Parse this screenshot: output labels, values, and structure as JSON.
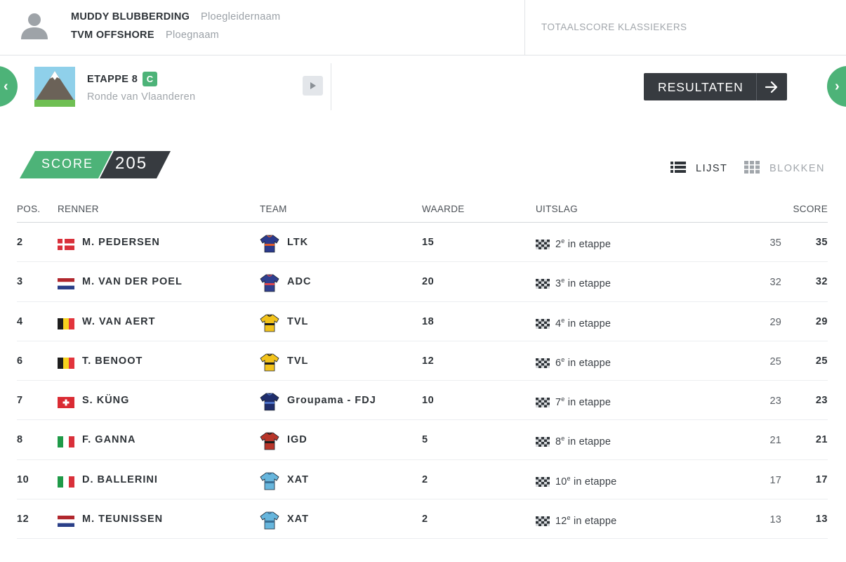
{
  "header": {
    "manager_name": "MUDDY BLUBBERDING",
    "manager_caption": "Ploegleidernaam",
    "team_name": "TVM OFFSHORE",
    "team_caption": "Ploegnaam",
    "total_score_label": "TOTAALSCORE KLASSIEKERS"
  },
  "stage": {
    "title": "ETAPPE 8",
    "badge": "C",
    "subtitle": "Ronde van Vlaanderen",
    "results_button": "RESULTATEN",
    "prev_label": "‹",
    "next_label": "›"
  },
  "score": {
    "label": "SCORE",
    "value": "205"
  },
  "view": {
    "list_label": "LIJST",
    "blocks_label": "BLOKKEN",
    "active": "list"
  },
  "table": {
    "headers": {
      "pos": "POS.",
      "rider": "RENNER",
      "team": "TEAM",
      "value": "WAARDE",
      "result": "UITSLAG",
      "score": "SCORE"
    },
    "rows": [
      {
        "pos": "2",
        "flag": "dk",
        "name": "M. PEDERSEN",
        "jersey": "ltk",
        "team": "LTK",
        "value": "15",
        "place": "2",
        "ordinal": "e",
        "result_suffix": " in etappe",
        "points": "35",
        "score": "35"
      },
      {
        "pos": "3",
        "flag": "nl",
        "name": "M. VAN DER POEL",
        "jersey": "adc",
        "team": "ADC",
        "value": "20",
        "place": "3",
        "ordinal": "e",
        "result_suffix": " in etappe",
        "points": "32",
        "score": "32"
      },
      {
        "pos": "4",
        "flag": "be",
        "name": "W. VAN AERT",
        "jersey": "tvl",
        "team": "TVL",
        "value": "18",
        "place": "4",
        "ordinal": "e",
        "result_suffix": " in etappe",
        "points": "29",
        "score": "29"
      },
      {
        "pos": "6",
        "flag": "be",
        "name": "T. BENOOT",
        "jersey": "tvl",
        "team": "TVL",
        "value": "12",
        "place": "6",
        "ordinal": "e",
        "result_suffix": " in etappe",
        "points": "25",
        "score": "25"
      },
      {
        "pos": "7",
        "flag": "ch",
        "name": "S. KÜNG",
        "jersey": "gfc",
        "team": "Groupama - FDJ",
        "value": "10",
        "place": "7",
        "ordinal": "e",
        "result_suffix": " in etappe",
        "points": "23",
        "score": "23"
      },
      {
        "pos": "8",
        "flag": "it",
        "name": "F. GANNA",
        "jersey": "igd",
        "team": "IGD",
        "value": "5",
        "place": "8",
        "ordinal": "e",
        "result_suffix": " in etappe",
        "points": "21",
        "score": "21"
      },
      {
        "pos": "10",
        "flag": "it",
        "name": "D. BALLERINI",
        "jersey": "xat",
        "team": "XAT",
        "value": "2",
        "place": "10",
        "ordinal": "e",
        "result_suffix": " in etappe",
        "points": "17",
        "score": "17"
      },
      {
        "pos": "12",
        "flag": "nl",
        "name": "M. TEUNISSEN",
        "jersey": "xat",
        "team": "XAT",
        "value": "2",
        "place": "12",
        "ordinal": "e",
        "result_suffix": " in etappe",
        "points": "13",
        "score": "13"
      }
    ]
  },
  "colors": {
    "accent_green": "#4db378",
    "dark": "#373b40",
    "muted": "#a1a6ab",
    "jerseys": {
      "ltk": {
        "body": "#2b3a8c",
        "trim": "#e05a2a"
      },
      "adc": {
        "body": "#2f3f8f",
        "trim": "#d8464f"
      },
      "tvl": {
        "body": "#f2c21a",
        "trim": "#1d1d1d"
      },
      "gfc": {
        "body": "#1f2d6b",
        "trim": "#4a6fc4"
      },
      "igd": {
        "body": "#b8352a",
        "trim": "#1d1d1d"
      },
      "xat": {
        "body": "#67b6dd",
        "trim": "#3a6f94"
      }
    }
  },
  "icons": {
    "avatar": "user-icon",
    "stage_image": "mountain-icon",
    "result": "checkered-flag-icon",
    "list_view": "list-icon",
    "blocks_view": "grid-icon",
    "expand": "play-icon",
    "results_arrow": "arrow-right-icon"
  }
}
